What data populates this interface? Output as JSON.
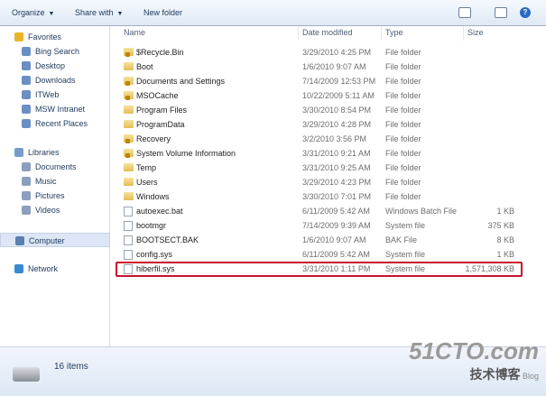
{
  "toolbar": {
    "organize": "Organize",
    "share_with": "Share with",
    "new_folder": "New folder",
    "help": "?"
  },
  "sidebar": {
    "favorites": "Favorites",
    "favorite_items": [
      "Bing Search",
      "Desktop",
      "Downloads",
      "ITWeb",
      "MSW Intranet",
      "Recent Places"
    ],
    "libraries": "Libraries",
    "library_items": [
      "Documents",
      "Music",
      "Pictures",
      "Videos"
    ],
    "computer": "Computer",
    "network": "Network"
  },
  "columns": {
    "name": "Name",
    "date": "Date modified",
    "type": "Type",
    "size": "Size"
  },
  "files": [
    {
      "name": "$Recycle.Bin",
      "date": "3/29/2010 4:25 PM",
      "type": "File folder",
      "size": "",
      "icon": "locked-folder"
    },
    {
      "name": "Boot",
      "date": "1/6/2010 9:07 AM",
      "type": "File folder",
      "size": "",
      "icon": "folder"
    },
    {
      "name": "Documents and Settings",
      "date": "7/14/2009 12:53 PM",
      "type": "File folder",
      "size": "",
      "icon": "locked-folder"
    },
    {
      "name": "MSOCache",
      "date": "10/22/2009 5:11 AM",
      "type": "File folder",
      "size": "",
      "icon": "locked-folder"
    },
    {
      "name": "Program Files",
      "date": "3/30/2010 8:54 PM",
      "type": "File folder",
      "size": "",
      "icon": "folder"
    },
    {
      "name": "ProgramData",
      "date": "3/29/2010 4:28 PM",
      "type": "File folder",
      "size": "",
      "icon": "folder"
    },
    {
      "name": "Recovery",
      "date": "3/2/2010 3:56 PM",
      "type": "File folder",
      "size": "",
      "icon": "locked-folder"
    },
    {
      "name": "System Volume Information",
      "date": "3/31/2010 9:21 AM",
      "type": "File folder",
      "size": "",
      "icon": "locked-folder"
    },
    {
      "name": "Temp",
      "date": "3/31/2010 9:25 AM",
      "type": "File folder",
      "size": "",
      "icon": "folder"
    },
    {
      "name": "Users",
      "date": "3/29/2010 4:23 PM",
      "type": "File folder",
      "size": "",
      "icon": "folder"
    },
    {
      "name": "Windows",
      "date": "3/30/2010 7:01 PM",
      "type": "File folder",
      "size": "",
      "icon": "folder"
    },
    {
      "name": "autoexec.bat",
      "date": "6/11/2009 5:42 AM",
      "type": "Windows Batch File",
      "size": "1 KB",
      "icon": "file"
    },
    {
      "name": "bootmgr",
      "date": "7/14/2009 9:39 AM",
      "type": "System file",
      "size": "375 KB",
      "icon": "file"
    },
    {
      "name": "BOOTSECT.BAK",
      "date": "1/6/2010 9:07 AM",
      "type": "BAK File",
      "size": "8 KB",
      "icon": "file"
    },
    {
      "name": "config.sys",
      "date": "6/11/2009 5:42 AM",
      "type": "System file",
      "size": "1 KB",
      "icon": "file"
    },
    {
      "name": "hiberfil.sys",
      "date": "3/31/2010 1:11 PM",
      "type": "System file",
      "size": "1,571,308 KB",
      "icon": "file"
    }
  ],
  "status": {
    "count": "16 items"
  },
  "watermark": {
    "site": "51CTO.com",
    "sub": "技术博客",
    "blog": "Blog"
  }
}
